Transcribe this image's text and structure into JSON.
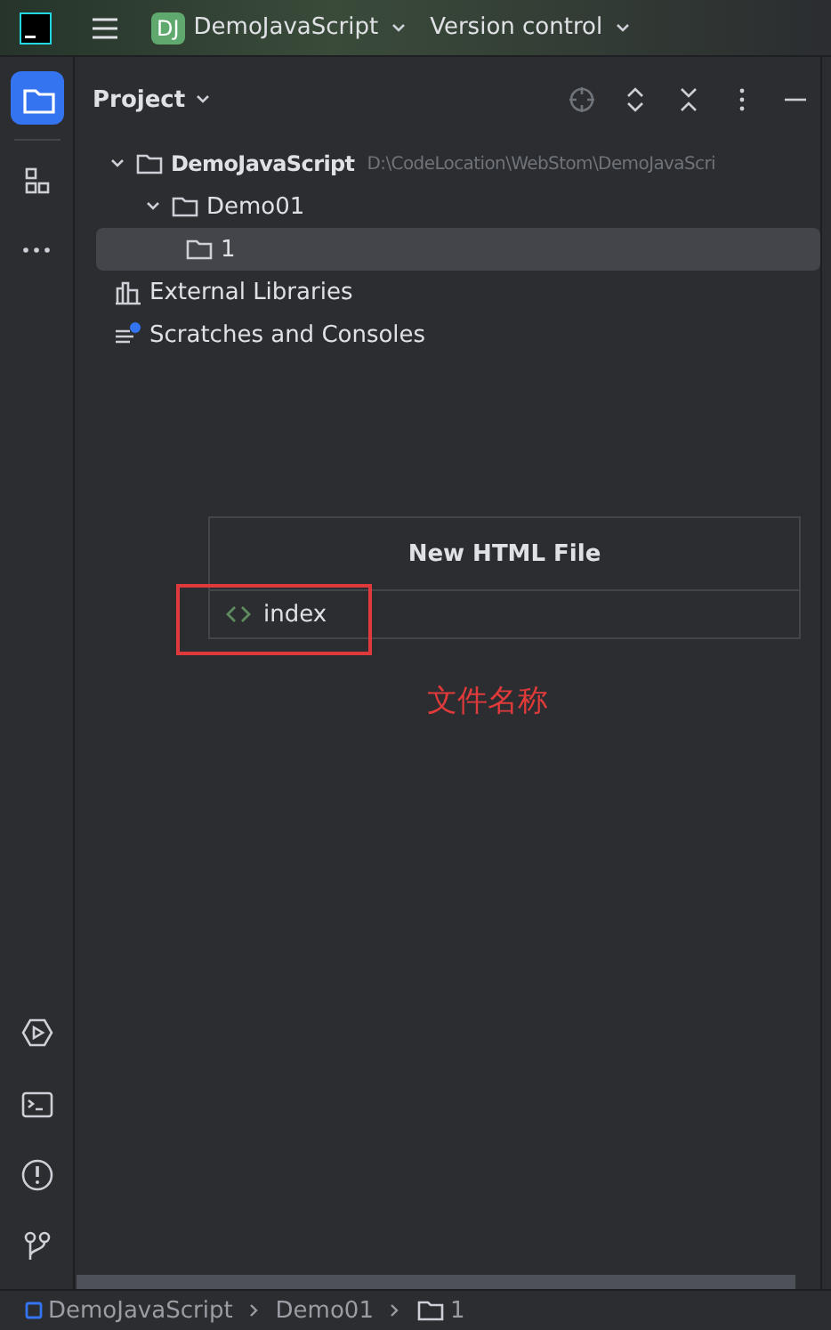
{
  "toolbar": {
    "project_badge": "DJ",
    "project_name": "DemoJavaScript",
    "vcs": "Version control"
  },
  "sidebar": {
    "items": [
      {
        "kind": "folder",
        "selected": true
      },
      {
        "kind": "structure",
        "selected": false
      },
      {
        "kind": "more",
        "selected": false
      }
    ],
    "bottom_items": [
      {
        "kind": "run"
      },
      {
        "kind": "terminal"
      },
      {
        "kind": "problems"
      },
      {
        "kind": "git"
      }
    ]
  },
  "panel": {
    "title": "Project"
  },
  "tree": [
    {
      "label": "DemoJavaScript",
      "kind": "folder",
      "bold": true,
      "path": "D:\\CodeLocation\\WebStom\\DemoJavaScri",
      "expanded": true,
      "selected": false,
      "children": [
        {
          "label": "Demo01",
          "kind": "folder",
          "expanded": true,
          "selected": false,
          "children": [
            {
              "label": "1",
              "kind": "folder",
              "selected": true
            }
          ]
        }
      ]
    },
    {
      "label": "External Libraries",
      "kind": "libraries",
      "selected": false
    },
    {
      "label": "Scratches and Consoles",
      "kind": "scratches",
      "selected": false
    }
  ],
  "dialog": {
    "title": "New HTML File",
    "value": "index"
  },
  "annotation": {
    "text": "文件名称"
  },
  "breadcrumbs": [
    {
      "label": "DemoJavaScript",
      "kind": "module"
    },
    {
      "label": "Demo01",
      "kind": "plain"
    },
    {
      "label": "1",
      "kind": "folder"
    }
  ]
}
